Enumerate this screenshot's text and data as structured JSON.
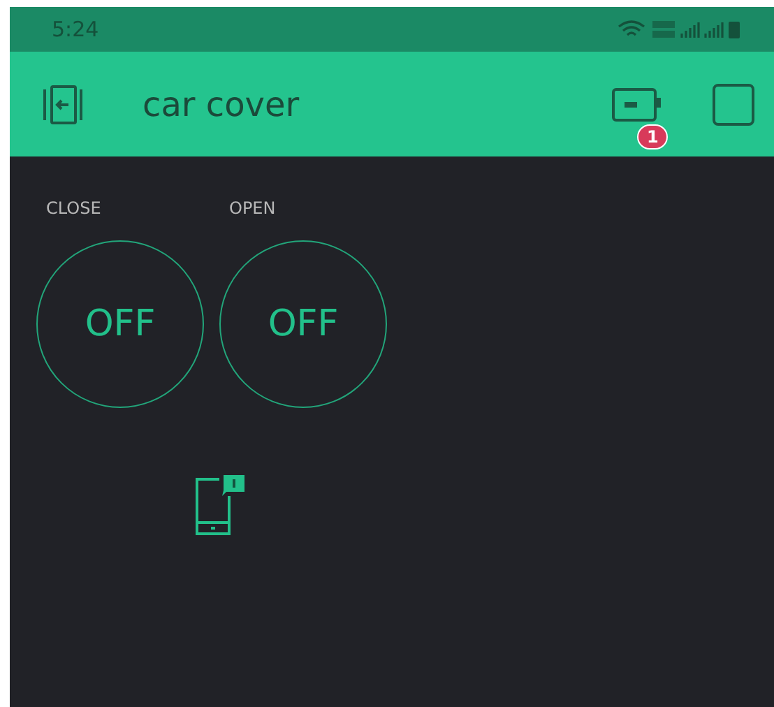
{
  "status_bar": {
    "time": "5:24"
  },
  "header": {
    "title": "car cover",
    "device_badge": "1"
  },
  "widgets": [
    {
      "kind": "button",
      "label": "CLOSE",
      "value": "OFF",
      "on": false
    },
    {
      "kind": "button",
      "label": "OPEN",
      "value": "OFF",
      "on": false
    }
  ],
  "notification_widget": {
    "kind": "phone"
  }
}
